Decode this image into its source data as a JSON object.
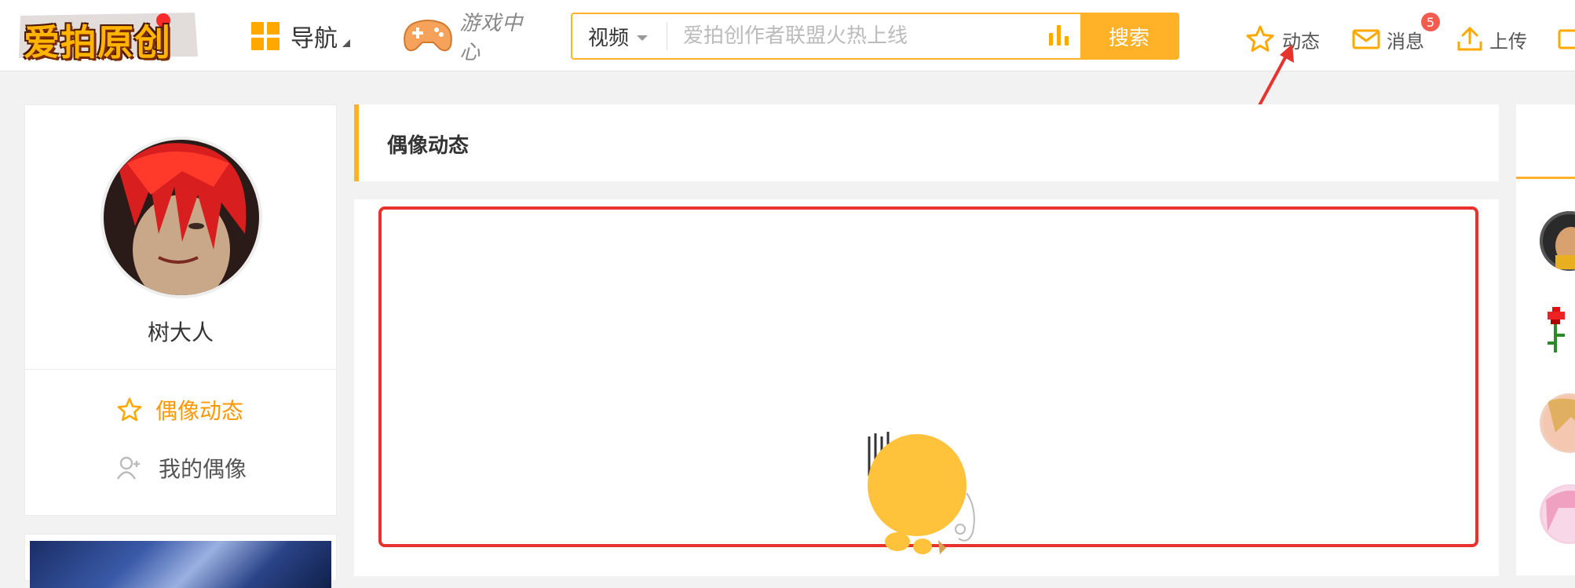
{
  "header": {
    "logo_text": "爱拍原创",
    "nav_label": "导航",
    "game_center_label": "游戏中心",
    "search": {
      "category": "视频",
      "placeholder": "爱拍创作者联盟火热上线",
      "button_label": "搜索"
    },
    "right_nav": {
      "dynamics_label": "动态",
      "messages_label": "消息",
      "messages_badge": "5",
      "upload_label": "上传"
    }
  },
  "sidebar": {
    "username": "树大人",
    "items": [
      {
        "label": "偶像动态",
        "icon": "star-icon",
        "active": true
      },
      {
        "label": "我的偶像",
        "icon": "users-add-icon",
        "active": false
      }
    ]
  },
  "main": {
    "section_title": "偶像动态"
  },
  "colors": {
    "accent": "#ffb128",
    "active_text": "#ff9800",
    "annotation_red": "#e8322d",
    "badge_red": "#f25b4e"
  }
}
